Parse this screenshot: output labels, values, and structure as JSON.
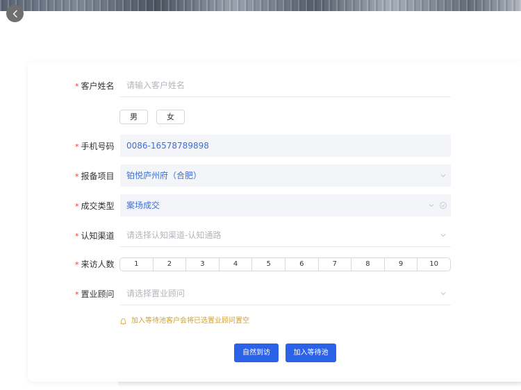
{
  "form": {
    "customer_name": {
      "label": "客户姓名",
      "placeholder": "请输入客户姓名"
    },
    "gender": {
      "male": "男",
      "female": "女"
    },
    "phone": {
      "label": "手机号码",
      "value": "0086-16578789898"
    },
    "project": {
      "label": "报备项目",
      "value": "铂悦庐州府（合肥）"
    },
    "deal_type": {
      "label": "成交类型",
      "value": "案场成交"
    },
    "channel": {
      "label": "认知渠道",
      "placeholder": "请选择认知渠道-认知通路"
    },
    "visitors": {
      "label": "来访人数",
      "options": [
        "1",
        "2",
        "3",
        "4",
        "5",
        "6",
        "7",
        "8",
        "9",
        "10"
      ]
    },
    "consultant": {
      "label": "置业顾问",
      "placeholder": "请选择置业顾问"
    },
    "required_mark": "*"
  },
  "tip": {
    "text": "加入等待池客户会将已选置业顾问置空",
    "icon": "bell-icon"
  },
  "actions": {
    "natural_visit": "自然到访",
    "join_pool": "加入等待池"
  },
  "colors": {
    "primary": "#2b62e8",
    "value_text": "#3a6fd8",
    "required": "#e23b3b",
    "warning": "#d4a125"
  }
}
